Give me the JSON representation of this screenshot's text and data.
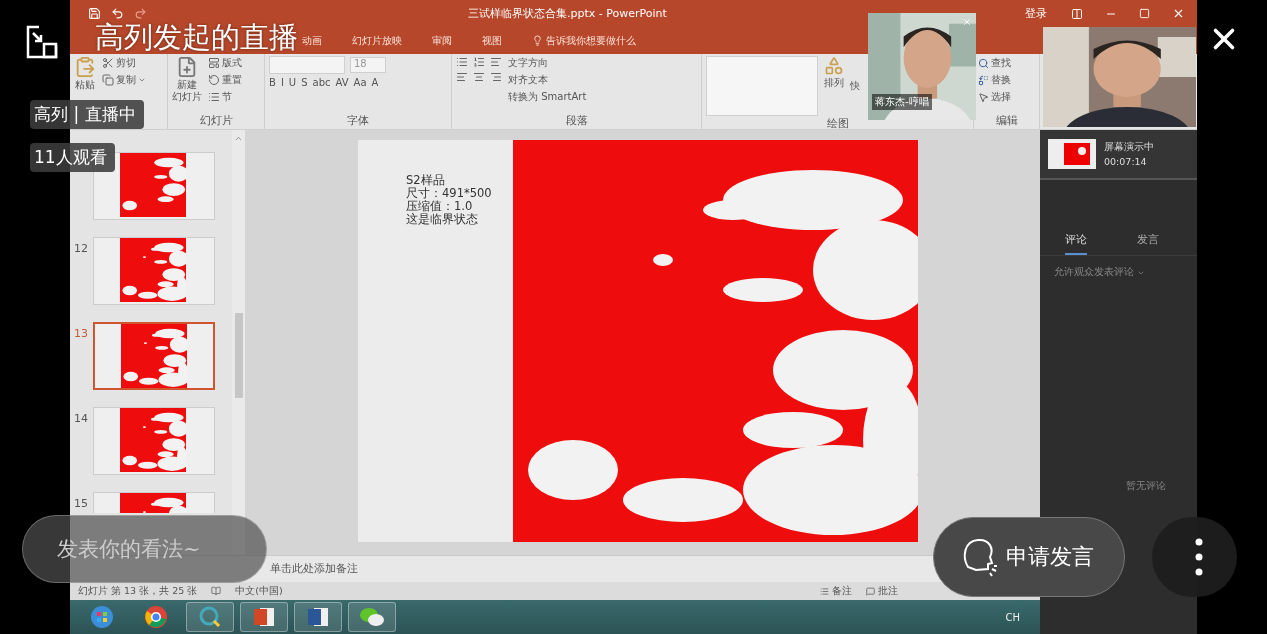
{
  "stream": {
    "title": "高列发起的直播",
    "host_status": "高列 | 直播中",
    "viewers": "11人观看",
    "comment_placeholder": "发表你的看法~",
    "speak_button": "申请发言",
    "guest_caption": "蒋东杰-哼唱"
  },
  "powerpoint": {
    "title": "三试样临界状态合集.pptx  -  PowerPoint",
    "sign_in": "登录",
    "tabs": [
      "动画",
      "幻灯片放映",
      "审阅",
      "视图"
    ],
    "tell_me": "告诉我你想要做什么",
    "clipboard": {
      "paste": "粘贴",
      "cut": "剪切",
      "copy": "复制"
    },
    "slides_group": {
      "new_slide": [
        "新建",
        "幻灯片"
      ],
      "layout": "版式",
      "reset": "重置",
      "section": "节",
      "label": "幻灯片"
    },
    "font": {
      "size": "18",
      "buttons": [
        "B",
        "I",
        "U",
        "S",
        "abc",
        "AV",
        "Aa",
        "A"
      ],
      "label": "字体"
    },
    "paragraph": {
      "text_direction": "文字方向",
      "align_text": "对齐文本",
      "smartart": "转换为 SmartArt",
      "label": "段落"
    },
    "drawing": {
      "arrange": "排列",
      "quick": "快",
      "label": "绘图"
    },
    "editing": {
      "find": "查找",
      "replace": "替换",
      "select": "选择",
      "label": "编辑"
    },
    "thumbnails": [
      {
        "selected": false
      },
      {
        "number": "12",
        "selected": false
      },
      {
        "number": "13",
        "selected": true
      },
      {
        "number": "14",
        "selected": false
      },
      {
        "number": "15",
        "selected": false
      }
    ],
    "slide_text": [
      "S2样品",
      "尺寸：491*500",
      "压缩值：1.0",
      "这是临界状态"
    ],
    "notes_placeholder": "单击此处添加备注",
    "status": {
      "slide_count": "幻灯片 第 13 张，共 25 张",
      "language": "中文(中国)",
      "notes": "备注",
      "comments": "批注"
    }
  },
  "side_panel": {
    "presenting": "屏幕演示中",
    "elapsed": "00:07:14",
    "tabs": [
      {
        "label": "评论",
        "selected": true
      },
      {
        "label": "发言",
        "selected": false
      }
    ],
    "permission": "允许观众发表评论",
    "empty": "暂无评论"
  },
  "taskbar": {
    "apps": [
      {
        "kind": "start"
      },
      {
        "kind": "chrome"
      },
      {
        "kind": "meeting"
      },
      {
        "kind": "powerpoint"
      },
      {
        "kind": "word"
      },
      {
        "kind": "wechat"
      }
    ],
    "tray": "CH"
  }
}
